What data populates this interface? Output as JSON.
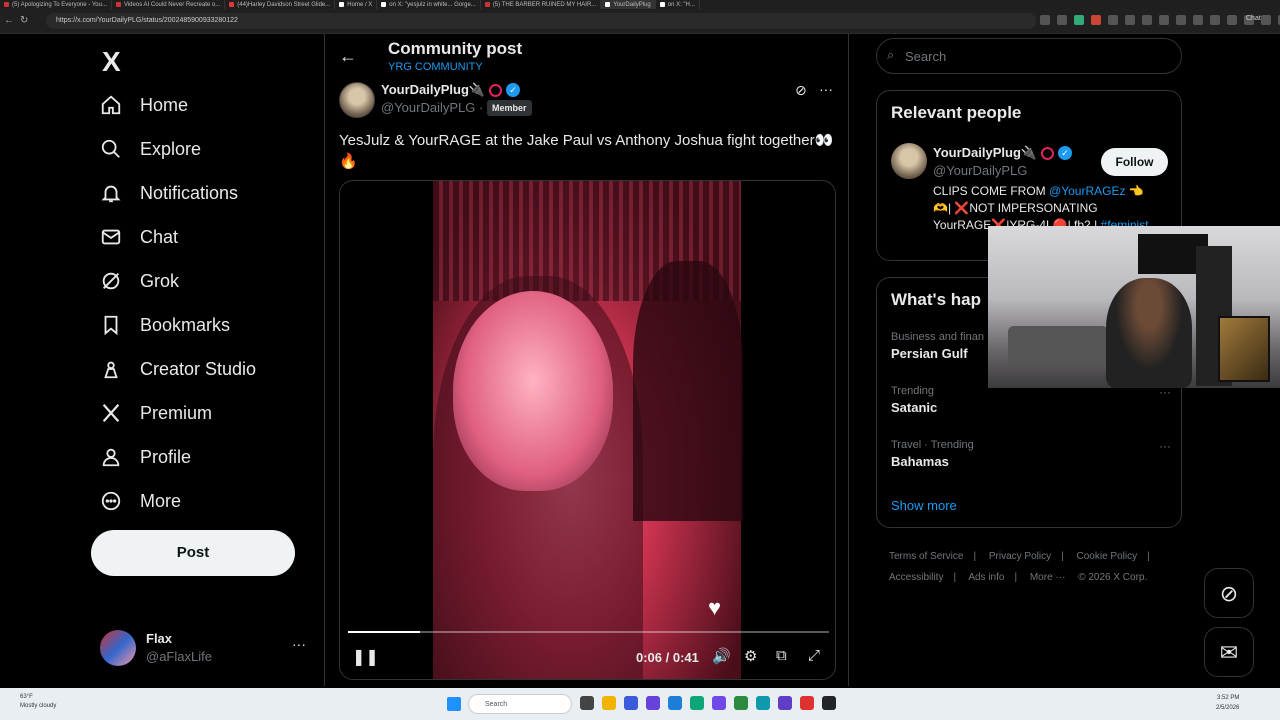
{
  "browser": {
    "tabs": [
      "(5) Apologizing To Everyone - You...",
      "Videos AI Could Never Recreate o...",
      "(44)Harley Davidson Street Glide...",
      "Home / X",
      "on X: \"yesjulz in white... Gorge...",
      "(5) THE BARBER RUINED MY HAIR...",
      "YourDailyPlug",
      "on X: \"H..."
    ],
    "url": "https://x.com/YourDailyPLG/status/2002485900933280122",
    "chat_label": "Chat"
  },
  "nav": {
    "logo": "X",
    "items": [
      {
        "label": "Home",
        "icon": "home-icon"
      },
      {
        "label": "Explore",
        "icon": "search-icon"
      },
      {
        "label": "Notifications",
        "icon": "bell-icon"
      },
      {
        "label": "Chat",
        "icon": "mail-icon"
      },
      {
        "label": "Grok",
        "icon": "grok-icon"
      },
      {
        "label": "Bookmarks",
        "icon": "bookmark-icon"
      },
      {
        "label": "Creator Studio",
        "icon": "creator-studio-icon"
      },
      {
        "label": "Premium",
        "icon": "x-premium-icon"
      },
      {
        "label": "Profile",
        "icon": "person-icon"
      },
      {
        "label": "More",
        "icon": "more-circle-icon"
      }
    ],
    "post_label": "Post",
    "account": {
      "name": "Flax",
      "handle": "@aFlaxLife",
      "menu": "···"
    }
  },
  "main": {
    "back_icon": "←",
    "title": "Community post",
    "community": "YRG COMMUNITY",
    "post": {
      "author_name": "YourDailyPlug🔌",
      "author_handle": "@YourDailyPLG",
      "separator": "·",
      "badge": "Member",
      "grok_icon": "⊘",
      "menu": "···",
      "text": "YesJulz & YourRAGE at the Jake Paul vs Anthony Joshua fight together👀🔥",
      "video": {
        "time_current": "0:06",
        "time_total": "0:41",
        "time_sep": " / ",
        "progress_fraction": 0.15,
        "pause_icon": "❚❚",
        "volume_icon": "🔊",
        "settings_icon": "⚙",
        "pip_icon": "⧉",
        "fullscreen_icon": "⤢",
        "heart_icon": "♥"
      }
    }
  },
  "right": {
    "search_placeholder": "Search",
    "search_icon": "⌕",
    "relevant": {
      "title": "Relevant people",
      "name": "YourDailyPlug🔌",
      "handle": "@YourDailyPLG",
      "follow_label": "Follow",
      "bio_1": "CLIPS COME FROM ",
      "bio_link": "@YourRAGEz",
      "bio_2": " 👈 🫶| ❌NOT IMPERSONATING YourRAGE❌|YRG-4L🔴| fb2 |",
      "bio_tag": "#feminist"
    },
    "happening": {
      "title": "What's hap",
      "trends": [
        {
          "category": "Business and finan",
          "title": "Persian Gulf"
        },
        {
          "category": "Trending",
          "title": "Satanic"
        },
        {
          "category": "Travel · Trending",
          "title": "Bahamas"
        }
      ],
      "trend_menu": "···",
      "show_more": "Show more"
    },
    "footer": {
      "links": [
        "Terms of Service",
        "Privacy Policy",
        "Cookie Policy",
        "Accessibility",
        "Ads info",
        "More ···"
      ],
      "sep": "|",
      "copyright": "© 2026 X Corp."
    },
    "fab_grok": "⊘",
    "fab_chat": "✉"
  },
  "taskbar": {
    "temp": "63°F",
    "weather": "Mostly cloudy",
    "search_placeholder": "Search",
    "time": "3:52 PM",
    "date": "2/5/2026"
  },
  "colors": {
    "accent": "#1d9bf0",
    "background": "#000000",
    "border": "#2f3336",
    "muted": "#71767b"
  }
}
